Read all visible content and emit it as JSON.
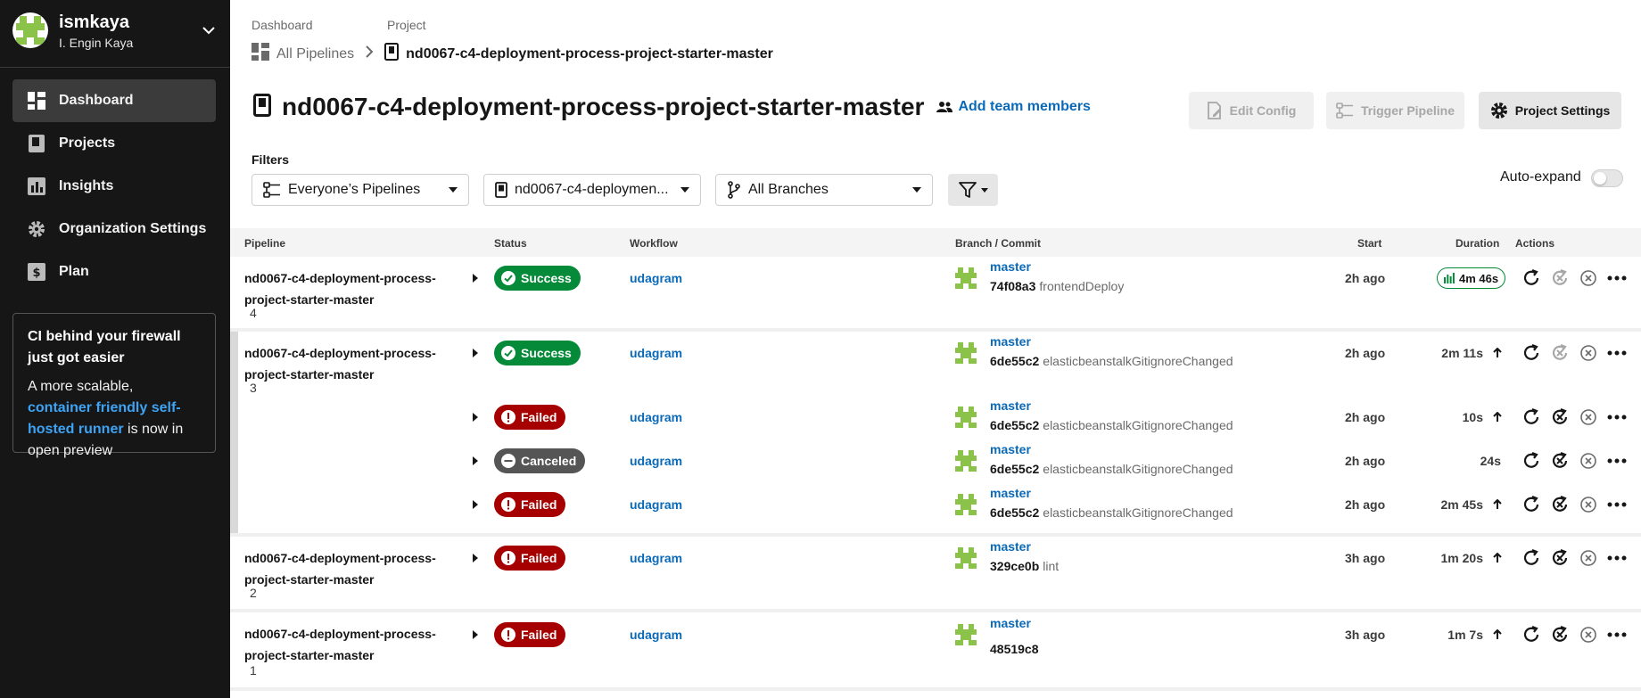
{
  "user": {
    "username": "ismkaya",
    "full_name": "I. Engin Kaya"
  },
  "nav": [
    {
      "label": "Dashboard",
      "icon": "dashboard-icon",
      "active": true
    },
    {
      "label": "Projects",
      "icon": "projects-icon"
    },
    {
      "label": "Insights",
      "icon": "insights-icon"
    },
    {
      "label": "Organization Settings",
      "icon": "gear-icon"
    },
    {
      "label": "Plan",
      "icon": "plan-icon"
    }
  ],
  "promo": {
    "title": "CI behind your firewall just got easier",
    "text_before": "A more scalable, ",
    "link": "container friendly self-hosted runner",
    "text_after": " is now in open preview"
  },
  "breadcrumb": {
    "top_left": "Dashboard",
    "top_right": "Project",
    "all_pipelines": "All Pipelines",
    "project": "nd0067-c4-deployment-process-project-starter-master"
  },
  "header": {
    "title": "nd0067-c4-deployment-process-project-starter-master",
    "add_team": "Add team members",
    "edit_config": "Edit Config",
    "trigger_pipeline": "Trigger Pipeline",
    "project_settings": "Project Settings"
  },
  "filters": {
    "label": "Filters",
    "pipelines": "Everyone’s Pipelines",
    "project": "nd0067-c4-deploymen...",
    "branches": "All Branches",
    "auto_expand": "Auto-expand",
    "auto_expand_on": false
  },
  "table": {
    "headers": {
      "pipeline": "Pipeline",
      "status": "Status",
      "workflow": "Workflow",
      "branch_commit": "Branch / Commit",
      "start": "Start",
      "duration": "Duration",
      "actions": "Actions"
    },
    "groups": [
      {
        "name_line1": "nd0067-c4-deployment-process-",
        "name_line2": "project-starter-master",
        "number": "4",
        "rows": [
          {
            "status": "Success",
            "workflow": "udagram",
            "branch": "master",
            "sha": "74f08a3",
            "message": "frontendDeploy",
            "start": "2h ago",
            "duration": "4m 46s",
            "running_chip": true
          }
        ]
      },
      {
        "name_line1": "nd0067-c4-deployment-process-",
        "name_line2": "project-starter-master",
        "number": "3",
        "rows": [
          {
            "status": "Success",
            "workflow": "udagram",
            "branch": "master",
            "sha": "6de55c2",
            "message": "elasticbeanstalkGitignoreChanged",
            "start": "2h ago",
            "duration": "2m 11s"
          },
          {
            "status": "Failed",
            "workflow": "udagram",
            "branch": "master",
            "sha": "6de55c2",
            "message": "elasticbeanstalkGitignoreChanged",
            "start": "2h ago",
            "duration": "10s"
          },
          {
            "status": "Canceled",
            "workflow": "udagram",
            "branch": "master",
            "sha": "6de55c2",
            "message": "elasticbeanstalkGitignoreChanged",
            "start": "2h ago",
            "duration": "24s"
          },
          {
            "status": "Failed",
            "workflow": "udagram",
            "branch": "master",
            "sha": "6de55c2",
            "message": "elasticbeanstalkGitignoreChanged",
            "start": "2h ago",
            "duration": "2m 45s"
          }
        ]
      },
      {
        "name_line1": "nd0067-c4-deployment-process-",
        "name_line2": "project-starter-master",
        "number": "2",
        "rows": [
          {
            "status": "Failed",
            "workflow": "udagram",
            "branch": "master",
            "sha": "329ce0b",
            "message": "lint",
            "start": "3h ago",
            "duration": "1m 20s"
          }
        ]
      },
      {
        "name_line1": "nd0067-c4-deployment-process-",
        "name_line2": "project-starter-master",
        "number": "1",
        "rows": [
          {
            "status": "Failed",
            "workflow": "udagram",
            "branch": "master",
            "sha": "48519c8",
            "message": "",
            "start": "3h ago",
            "duration": "1m 7s"
          }
        ]
      }
    ]
  },
  "colors": {
    "success": "#048a38",
    "failed": "#a60000",
    "canceled": "#555555",
    "link": "#0b6ab8",
    "sidebar": "#161616"
  }
}
